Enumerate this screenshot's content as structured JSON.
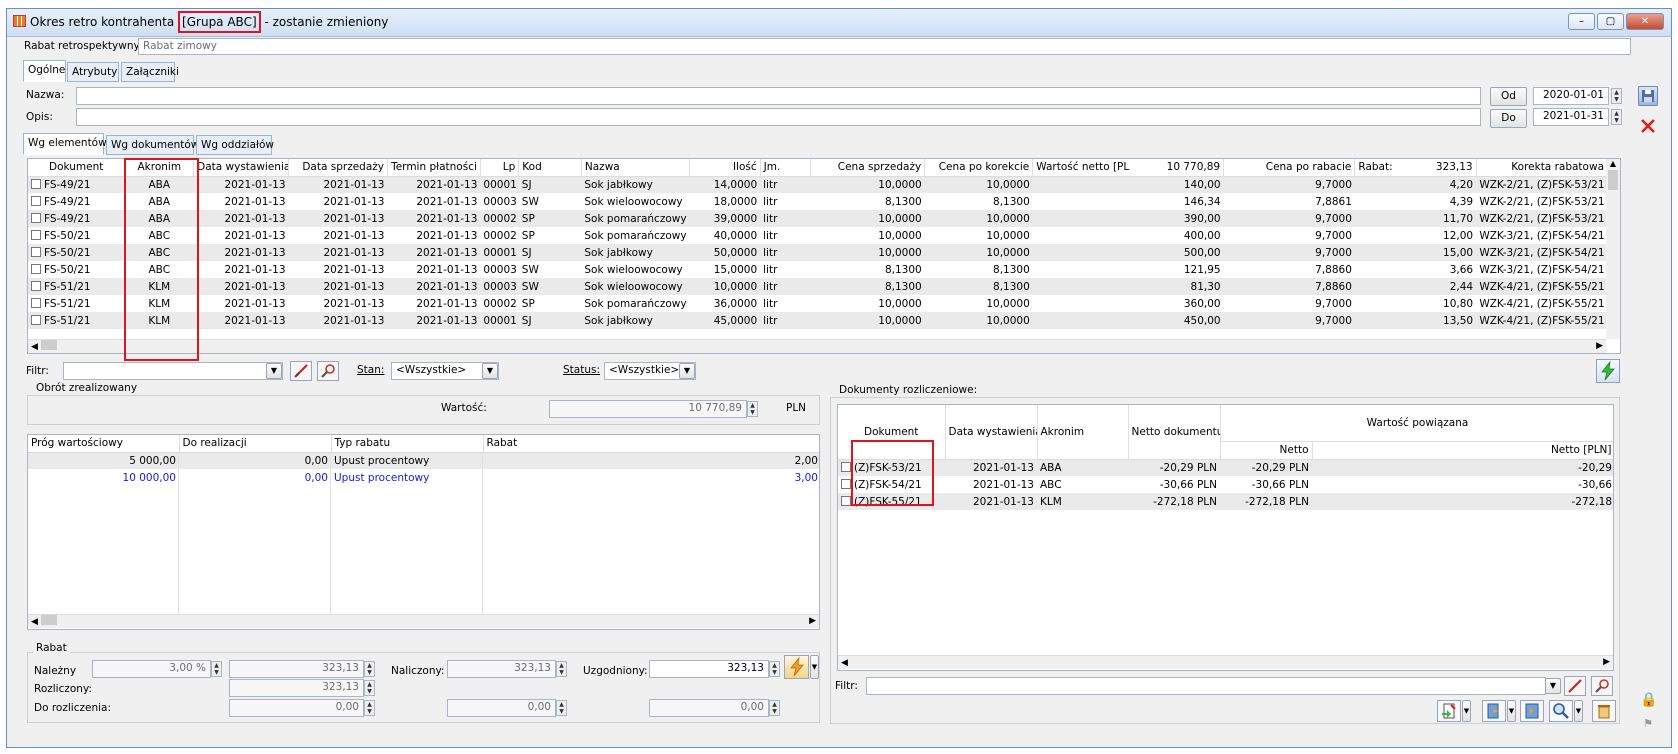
{
  "window": {
    "title_prefix": "Okres retro kontrahenta",
    "title_group": "[Grupa ABC]",
    "title_suffix": "- zostanie zmieniony",
    "minimize": "–",
    "maximize": "▢",
    "close": "✕"
  },
  "header": {
    "rabat_label": "Rabat retrospektywny:",
    "rabat_value": "Rabat zimowy"
  },
  "tabs": [
    "Ogólne",
    "Atrybuty",
    "Załączniki"
  ],
  "form": {
    "nazwa_label": "Nazwa:",
    "opis_label": "Opis:",
    "od_button": "Od",
    "do_button": "Do",
    "od_date": "2020-01-01",
    "do_date": "2021-01-31"
  },
  "subtabs": [
    "Wg elementów",
    "Wg dokumentów",
    "Wg oddziałów"
  ],
  "elements_table": {
    "headers": [
      "Dokument",
      "Akronim",
      "Data wystawienia",
      "Data sprzedaży",
      "Termin płatności",
      "Lp",
      "Kod",
      "Nazwa",
      "Ilość",
      "Jm.",
      "Cena sprzedaży",
      "Cena po korekcie",
      "Wartość netto [PLN]:",
      "10 770,89",
      "Cena po rabacie",
      "Rabat:",
      "323,13",
      "Korekta rabatowa"
    ],
    "rows": [
      [
        "FS-49/21",
        "ABA",
        "2021-01-13",
        "2021-01-13",
        "2021-01-13",
        "00001",
        "SJ",
        "Sok jabłkowy",
        "14,0000",
        "litr",
        "10,0000",
        "10,0000",
        "140,00",
        "9,7000",
        "4,20",
        "WZK-2/21, (Z)FSK-53/21"
      ],
      [
        "FS-49/21",
        "ABA",
        "2021-01-13",
        "2021-01-13",
        "2021-01-13",
        "00003",
        "SW",
        "Sok wieloowocowy",
        "18,0000",
        "litr",
        "8,1300",
        "8,1300",
        "146,34",
        "7,8861",
        "4,39",
        "WZK-2/21, (Z)FSK-53/21"
      ],
      [
        "FS-49/21",
        "ABA",
        "2021-01-13",
        "2021-01-13",
        "2021-01-13",
        "00002",
        "SP",
        "Sok pomarańczowy",
        "39,0000",
        "litr",
        "10,0000",
        "10,0000",
        "390,00",
        "9,7000",
        "11,70",
        "WZK-2/21, (Z)FSK-53/21"
      ],
      [
        "FS-50/21",
        "ABC",
        "2021-01-13",
        "2021-01-13",
        "2021-01-13",
        "00002",
        "SP",
        "Sok pomarańczowy",
        "40,0000",
        "litr",
        "10,0000",
        "10,0000",
        "400,00",
        "9,7000",
        "12,00",
        "WZK-3/21, (Z)FSK-54/21"
      ],
      [
        "FS-50/21",
        "ABC",
        "2021-01-13",
        "2021-01-13",
        "2021-01-13",
        "00001",
        "SJ",
        "Sok jabłkowy",
        "50,0000",
        "litr",
        "10,0000",
        "10,0000",
        "500,00",
        "9,7000",
        "15,00",
        "WZK-3/21, (Z)FSK-54/21"
      ],
      [
        "FS-50/21",
        "ABC",
        "2021-01-13",
        "2021-01-13",
        "2021-01-13",
        "00003",
        "SW",
        "Sok wieloowocowy",
        "15,0000",
        "litr",
        "8,1300",
        "8,1300",
        "121,95",
        "7,8860",
        "3,66",
        "WZK-3/21, (Z)FSK-54/21"
      ],
      [
        "FS-51/21",
        "KLM",
        "2021-01-13",
        "2021-01-13",
        "2021-01-13",
        "00003",
        "SW",
        "Sok wieloowocowy",
        "10,0000",
        "litr",
        "8,1300",
        "8,1300",
        "81,30",
        "7,8860",
        "2,44",
        "WZK-4/21, (Z)FSK-55/21"
      ],
      [
        "FS-51/21",
        "KLM",
        "2021-01-13",
        "2021-01-13",
        "2021-01-13",
        "00002",
        "SP",
        "Sok pomarańczowy",
        "36,0000",
        "litr",
        "10,0000",
        "10,0000",
        "360,00",
        "9,7000",
        "10,80",
        "WZK-4/21, (Z)FSK-55/21"
      ],
      [
        "FS-51/21",
        "KLM",
        "2021-01-13",
        "2021-01-13",
        "2021-01-13",
        "00001",
        "SJ",
        "Sok jabłkowy",
        "45,0000",
        "litr",
        "10,0000",
        "10,0000",
        "450,00",
        "9,7000",
        "13,50",
        "WZK-4/21, (Z)FSK-55/21"
      ]
    ]
  },
  "filter_bar": {
    "filtr_label": "Filtr:",
    "stan_label": "Stan:",
    "stan_value": "<Wszystkie>",
    "status_label": "Status:",
    "status_value": "<Wszystkie>"
  },
  "obrot": {
    "group_label": "Obrót zrealizowany",
    "wartosc_label": "Wartość:",
    "wartosc_value": "10 770,89",
    "currency": "PLN"
  },
  "progi_table": {
    "headers": [
      "Próg wartościowy",
      "Do realizacji",
      "Typ rabatu",
      "Rabat"
    ],
    "rows": [
      [
        "5 000,00",
        "0,00",
        "Upust procentowy",
        "2,00"
      ],
      [
        "10 000,00",
        "0,00",
        "Upust procentowy",
        "3,00"
      ]
    ]
  },
  "rabat": {
    "group_label": "Rabat",
    "nalezny_label": "Należny",
    "nalezny_pct": "3,00 %",
    "nalezny_value": "323,13",
    "rozliczony_label": "Rozliczony:",
    "rozliczony_value": "323,13",
    "do_rozliczenia_label": "Do rozliczenia:",
    "do_rozliczenia_value": "0,00",
    "naliczony_label": "Naliczony:",
    "naliczony_value": "323,13",
    "naliczony_rest": "0,00",
    "uzgodniony_label": "Uzgodniony:",
    "uzgodniony_value": "323,13",
    "uzgodniony_rest": "0,00"
  },
  "rozliczeniowe": {
    "group_label": "Dokumenty rozliczeniowe:",
    "headers": [
      "Dokument",
      "Data wystawienia",
      "Akronim",
      "Netto dokumentu",
      "Wartość powiązana",
      "Netto",
      "Netto [PLN]"
    ],
    "rows": [
      [
        "(Z)FSK-53/21",
        "2021-01-13",
        "ABA",
        "-20,29 PLN",
        "-20,29 PLN",
        "-20,29"
      ],
      [
        "(Z)FSK-54/21",
        "2021-01-13",
        "ABC",
        "-30,66 PLN",
        "-30,66 PLN",
        "-30,66"
      ],
      [
        "(Z)FSK-55/21",
        "2021-01-13",
        "KLM",
        "-272,18 PLN",
        "-272,18 PLN",
        "-272,18"
      ]
    ],
    "filtr_label": "Filtr:"
  },
  "colors": {
    "highlight": "#e0141e",
    "alt_row": "#eaeaea",
    "blue_row": "#1a1adf"
  }
}
